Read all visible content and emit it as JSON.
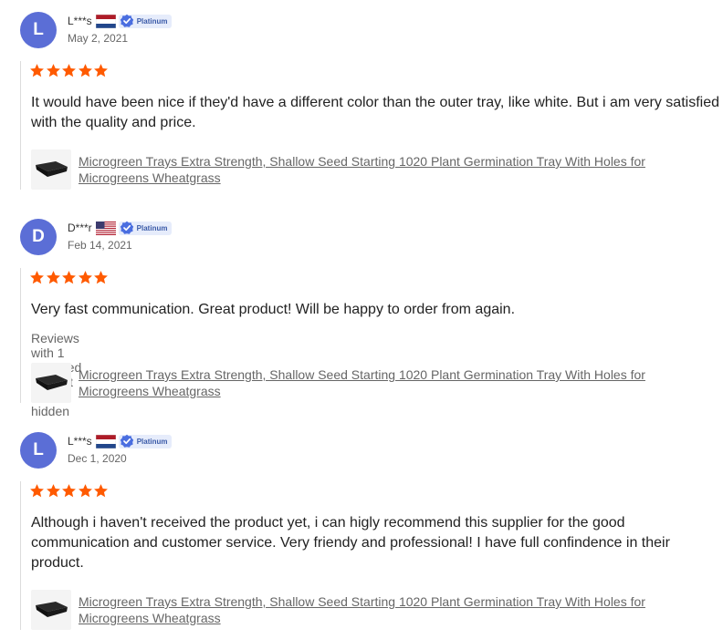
{
  "reviews": [
    {
      "avatar_letter": "L",
      "username": "L***s",
      "country": "Netherlands",
      "badge": "Platinum",
      "date": "May 2, 2021",
      "rating": 5,
      "text": "It would have been nice if they'd have a different color than the outer tray, like white. But i am very satisfied with the quality and price.",
      "hidden_note": "",
      "product": "Microgreen Trays Extra Strength, Shallow Seed Starting 1020 Plant Germination Tray With Holes for Microgreens Wheatgrass"
    },
    {
      "avatar_letter": "D",
      "username": "D***r",
      "country": "United States",
      "badge": "Platinum",
      "date": "Feb 14, 2021",
      "rating": 5,
      "text": "Very fast communication. Great product! Will be happy to order from again.",
      "hidden_note": "Reviews with 1 repeated content are hidden",
      "product": "Microgreen Trays Extra Strength, Shallow Seed Starting 1020 Plant Germination Tray With Holes for Microgreens Wheatgrass"
    },
    {
      "avatar_letter": "L",
      "username": "L***s",
      "country": "Netherlands",
      "badge": "Platinum",
      "date": "Dec 1, 2020",
      "rating": 5,
      "text": "Although i haven't received the product yet, i can higly recommend this supplier for the good communication and customer service. Very friendy and professional! I have full confindence in their product.",
      "hidden_note": "",
      "product": "Microgreen Trays Extra Strength, Shallow Seed Starting 1020 Plant Germination Tray With Holes for Microgreens Wheatgrass"
    }
  ],
  "colors": {
    "avatar_bg": "#5b6ed6",
    "star": "#ff5a00",
    "badge_bg": "#e6ecfb",
    "badge_text": "#3a5aa8"
  },
  "icons": {
    "star": "star-icon",
    "badge": "verified-badge-icon",
    "product_thumb": "tray-thumbnail"
  }
}
